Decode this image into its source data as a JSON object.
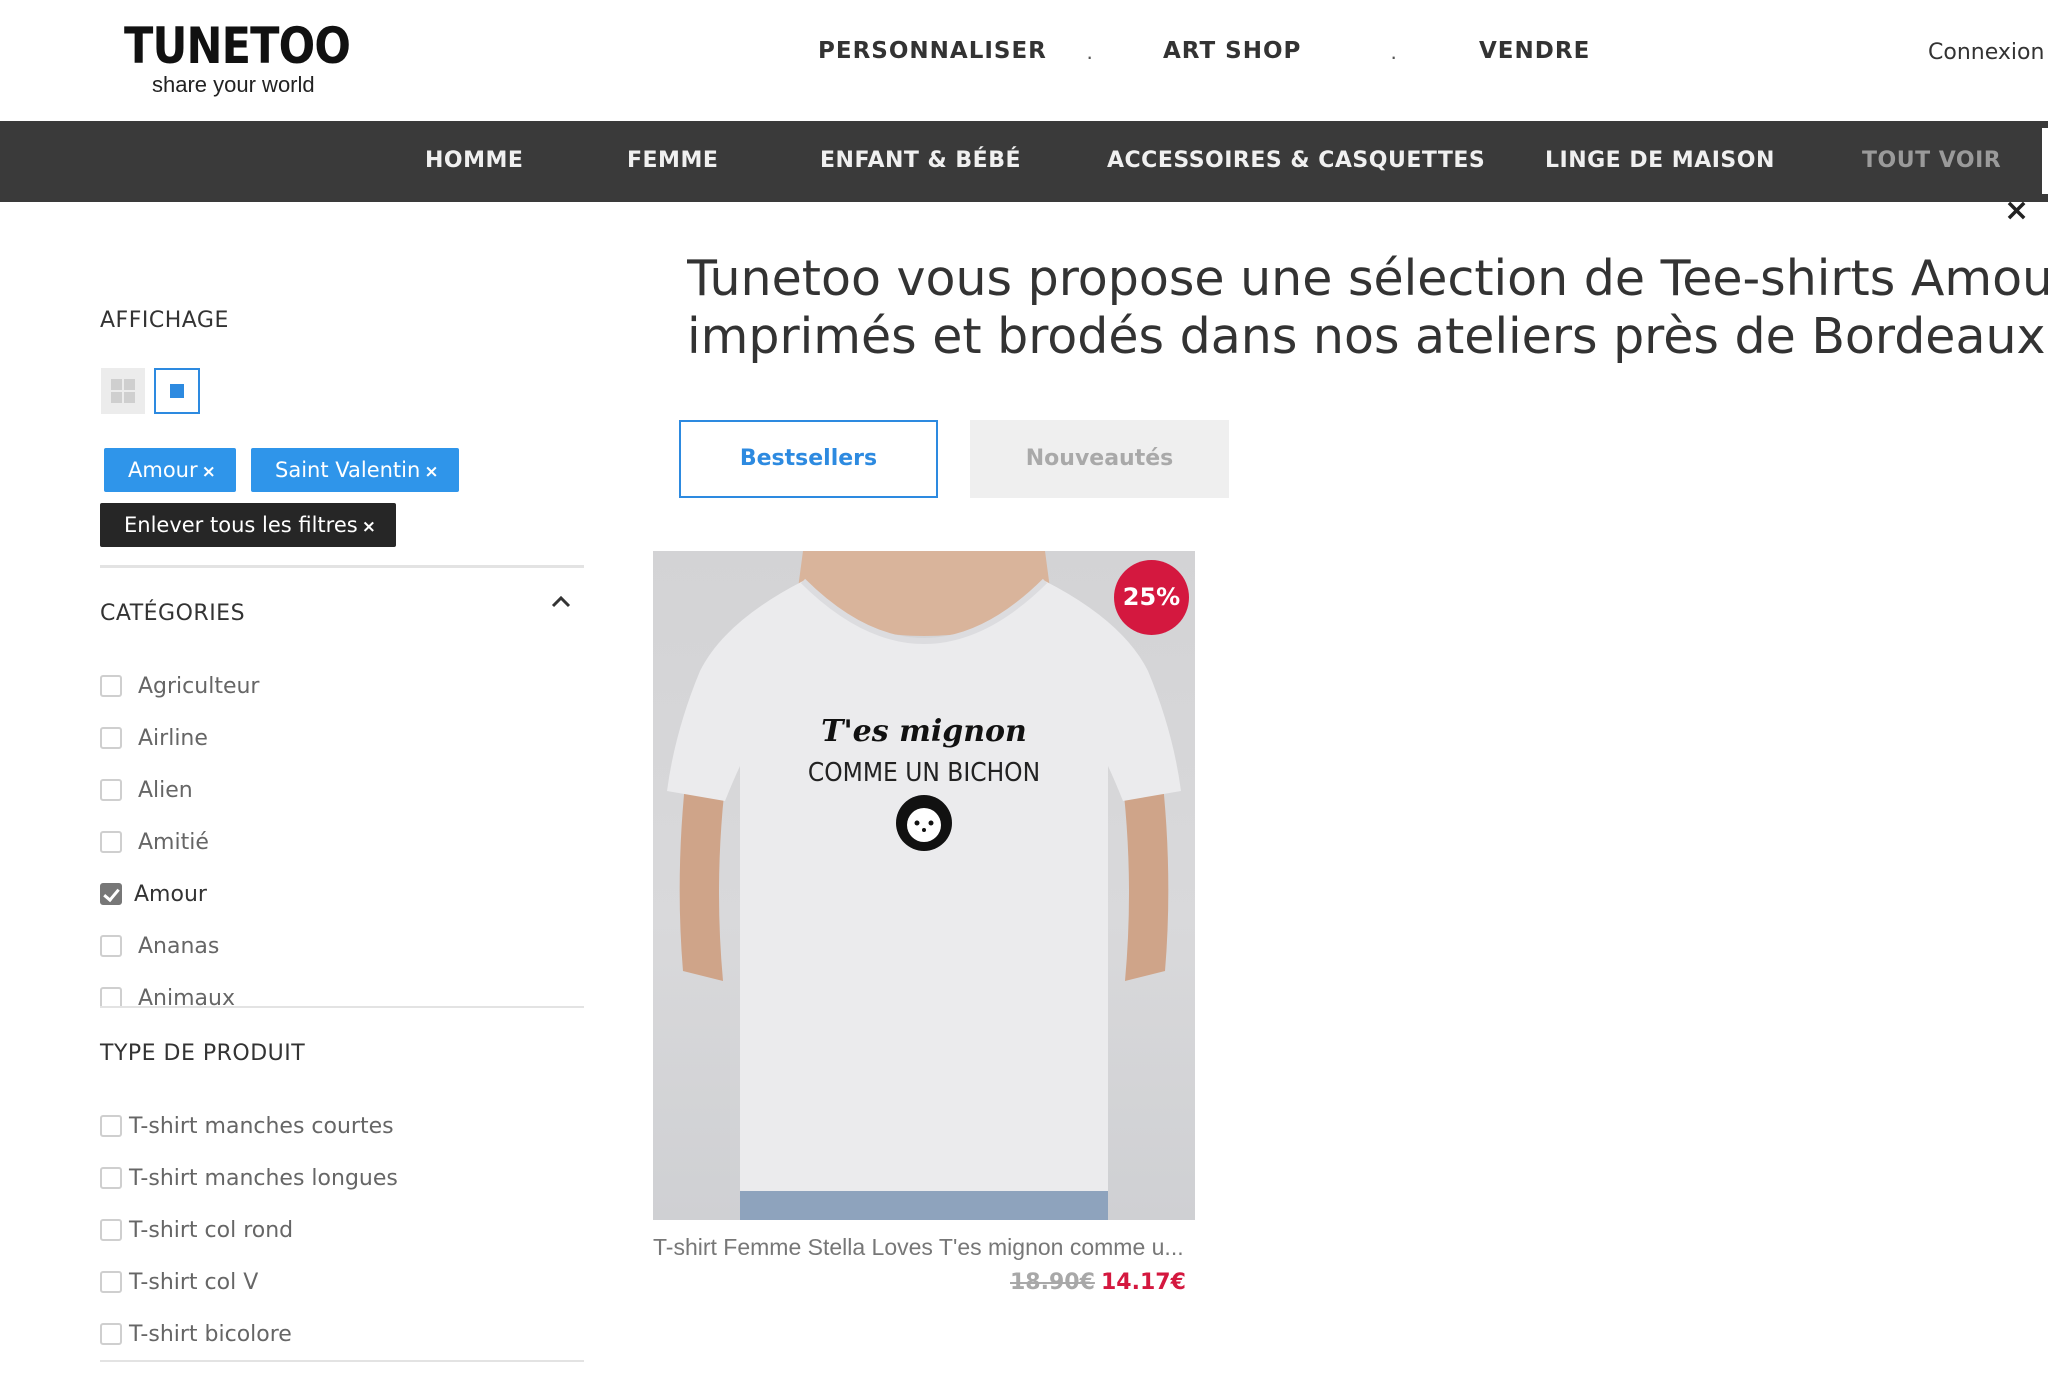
{
  "header": {
    "logo_word": "TUNETOO",
    "logo_tagline": "share your world",
    "nav": [
      "PERSONNALISER",
      "ART SHOP",
      "VENDRE"
    ],
    "nav_separator": "·",
    "connexion_label": "Connexion"
  },
  "category_bar": {
    "items": [
      "HOMME",
      "FEMME",
      "ENFANT & BÉBÉ",
      "ACCESSOIRES & CASQUETTES",
      "LINGE DE MAISON",
      "TOUT VOIR"
    ]
  },
  "close_label": "×",
  "sidebar": {
    "display_title": "AFFICHAGE",
    "active_filters": [
      "Amour",
      "Saint Valentin"
    ],
    "remove_all_label": "Enlever tous les filtres",
    "remove_glyph": "×",
    "categories_title": "CATÉGORIES",
    "categories": [
      {
        "label": "Agriculteur",
        "checked": false
      },
      {
        "label": "Airline",
        "checked": false
      },
      {
        "label": "Alien",
        "checked": false
      },
      {
        "label": "Amitié",
        "checked": false
      },
      {
        "label": "Amour",
        "checked": true
      },
      {
        "label": "Ananas",
        "checked": false
      },
      {
        "label": "Animaux",
        "checked": false
      }
    ],
    "product_type_title": "TYPE DE PRODUIT",
    "product_types": [
      {
        "label": "T-shirt manches courtes",
        "checked": false
      },
      {
        "label": "T-shirt manches longues",
        "checked": false
      },
      {
        "label": "T-shirt col rond",
        "checked": false
      },
      {
        "label": "T-shirt col V",
        "checked": false
      },
      {
        "label": "T-shirt bicolore",
        "checked": false
      }
    ]
  },
  "main": {
    "headline_line1": "Tunetoo vous propose une sélection de Tee-shirts Amour, S",
    "headline_line2": "imprimés et brodés dans nos ateliers près de Bordeaux.",
    "tabs": [
      "Bestsellers",
      "Nouveautés"
    ],
    "product": {
      "discount": "25%",
      "print_line1": "T'es mignon",
      "print_line2": "COMME UN BICHON",
      "name": "T-shirt Femme Stella Loves T'es mignon comme u...",
      "price_old": "18.90€",
      "price_new": "14.17€"
    }
  },
  "colors": {
    "accent": "#2d8ae0",
    "chip": "#2f95ea",
    "dark_bar": "#3a3a3a",
    "sale": "#d4183f"
  }
}
